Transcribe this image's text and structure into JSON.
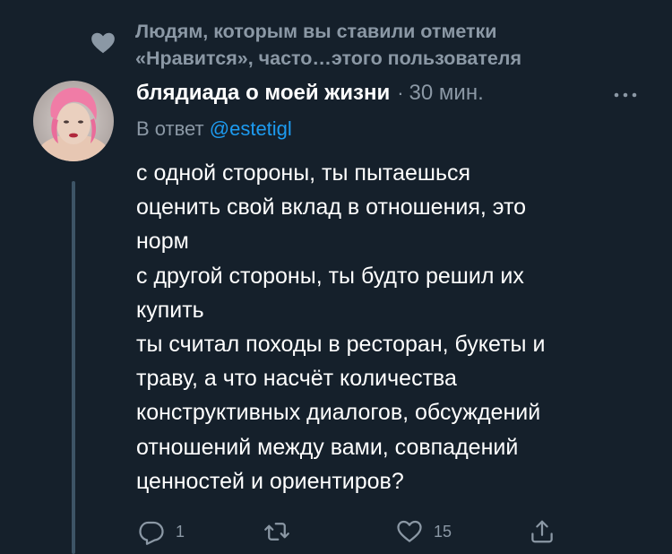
{
  "social_context": {
    "icon": "heart-icon",
    "line1": "Людям, которым вы ставили отметки",
    "line2": "«Нравится», часто…этого пользователя"
  },
  "tweet": {
    "display_name": "блядиада о моей жизни",
    "separator": "·",
    "time": "30 мин.",
    "reply_prefix": "В ответ",
    "reply_handle": "@estetigl",
    "body_lines": [
      "с одной стороны, ты пытаешься",
      "оценить свой вклад в отношения, это",
      "норм",
      "с другой стороны, ты будто решил их",
      "купить",
      "ты считал походы в ресторан, букеты и",
      "траву, а что насчёт количества",
      "конструктивных диалогов, обсуждений",
      "отношений между вами, совпадений",
      "ценностей и ориентиров?"
    ]
  },
  "actions": {
    "reply_count": "1",
    "retweet_count": "",
    "like_count": "15",
    "share_count": ""
  },
  "colors": {
    "background": "#15202b",
    "secondary_text": "#8b98a5",
    "link": "#1d9bf0",
    "thread_line": "#3d5466"
  }
}
